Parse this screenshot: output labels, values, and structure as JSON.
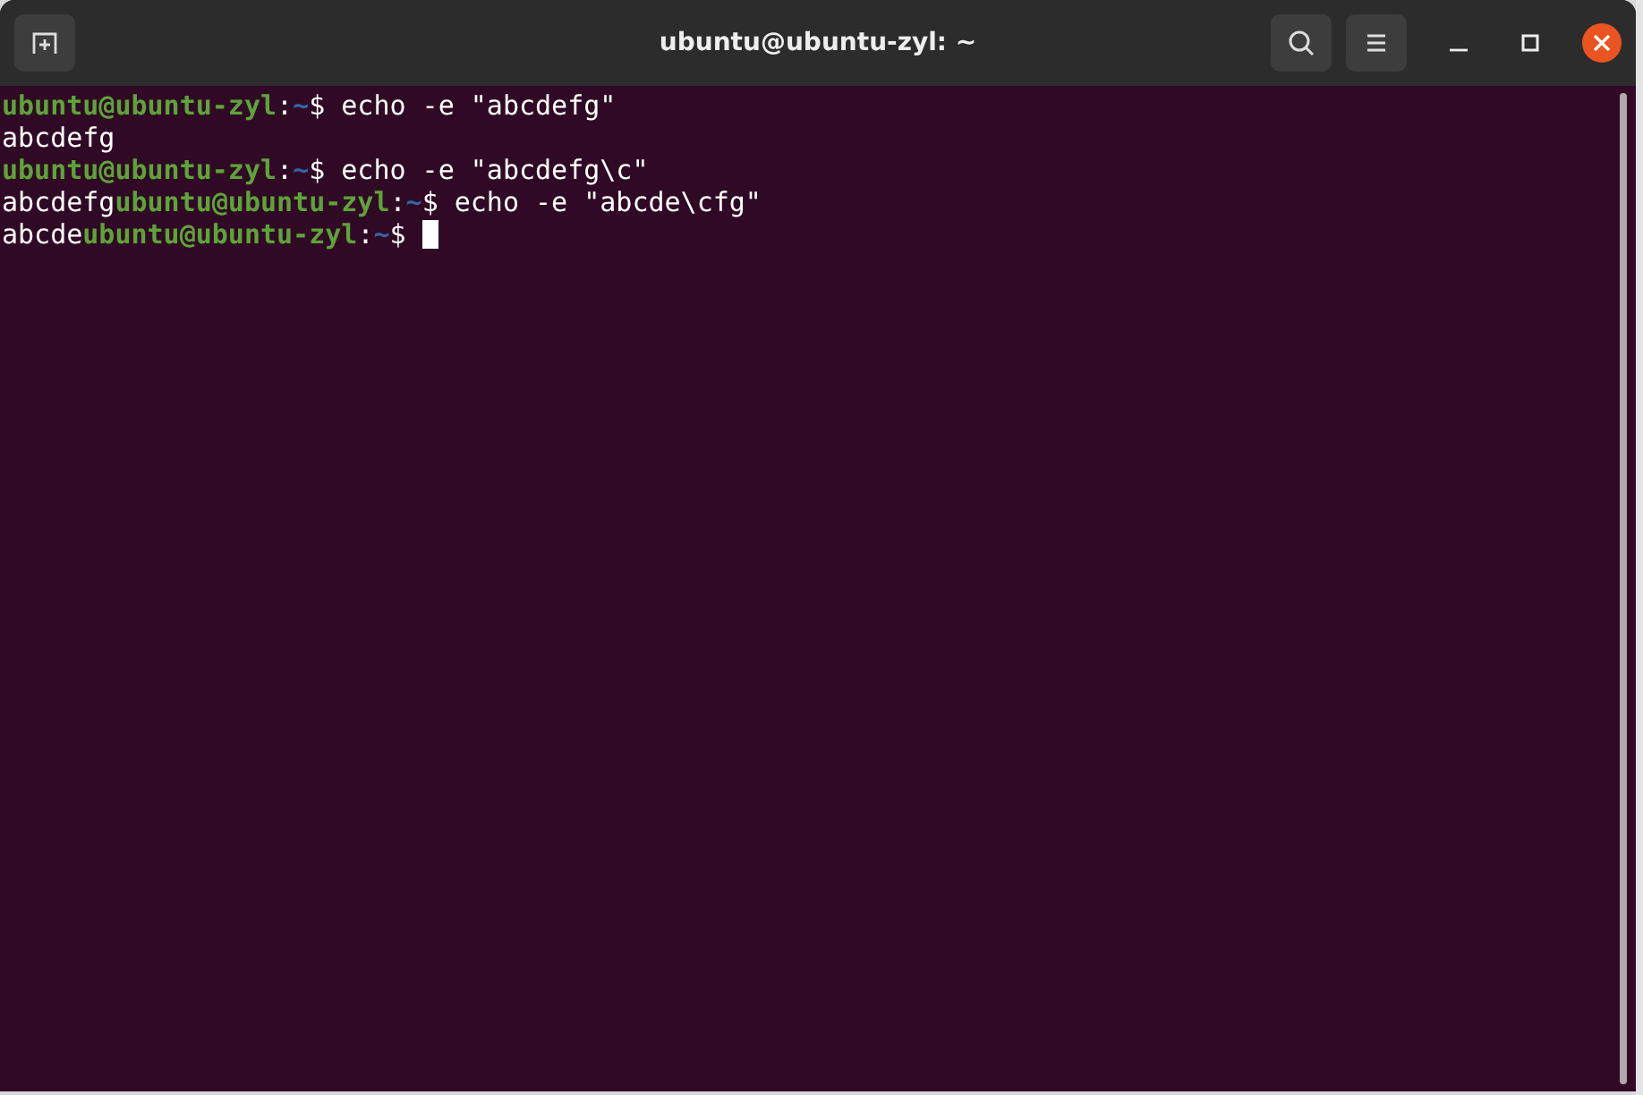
{
  "window": {
    "title": "ubuntu@ubuntu-zyl: ~"
  },
  "terminal": {
    "cursor": true,
    "lines": [
      {
        "segments": [
          {
            "kind": "user",
            "text": "ubuntu@ubuntu-zyl"
          },
          {
            "kind": "plain",
            "text": ":"
          },
          {
            "kind": "path",
            "text": "~"
          },
          {
            "kind": "plain",
            "text": "$ echo -e \"abcdefg\""
          }
        ]
      },
      {
        "segments": [
          {
            "kind": "plain",
            "text": "abcdefg"
          }
        ]
      },
      {
        "segments": [
          {
            "kind": "user",
            "text": "ubuntu@ubuntu-zyl"
          },
          {
            "kind": "plain",
            "text": ":"
          },
          {
            "kind": "path",
            "text": "~"
          },
          {
            "kind": "plain",
            "text": "$ echo -e \"abcdefg\\c\""
          }
        ]
      },
      {
        "segments": [
          {
            "kind": "plain",
            "text": "abcdefg"
          },
          {
            "kind": "user",
            "text": "ubuntu@ubuntu-zyl"
          },
          {
            "kind": "plain",
            "text": ":"
          },
          {
            "kind": "path",
            "text": "~"
          },
          {
            "kind": "plain",
            "text": "$ echo -e \"abcde\\cfg\""
          }
        ]
      },
      {
        "segments": [
          {
            "kind": "plain",
            "text": "abcde"
          },
          {
            "kind": "user",
            "text": "ubuntu@ubuntu-zyl"
          },
          {
            "kind": "plain",
            "text": ":"
          },
          {
            "kind": "path",
            "text": "~"
          },
          {
            "kind": "plain",
            "text": "$ "
          }
        ]
      }
    ]
  }
}
